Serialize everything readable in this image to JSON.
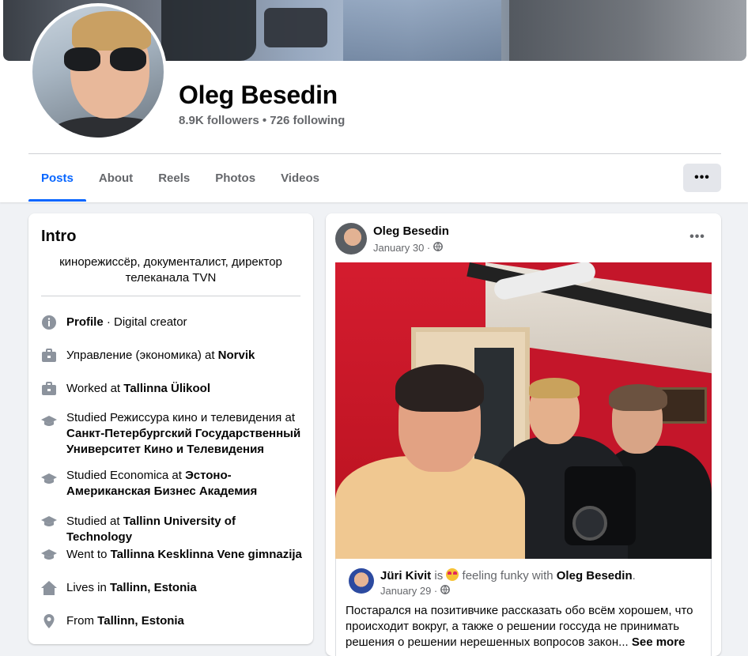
{
  "profile": {
    "name": "Oleg Besedin",
    "stats": "8.9K followers • 726 following"
  },
  "tabs": [
    {
      "label": "Posts",
      "active": true
    },
    {
      "label": "About",
      "active": false
    },
    {
      "label": "Reels",
      "active": false
    },
    {
      "label": "Photos",
      "active": false
    },
    {
      "label": "Videos",
      "active": false
    }
  ],
  "more_label": "•••",
  "intro": {
    "title": "Intro",
    "bio": "кинорежиссёр, документалист, директор телеканала TVN",
    "items": [
      {
        "icon": "info-icon",
        "prefix": "",
        "bold": "Profile",
        "suffix": " · Digital creator"
      },
      {
        "icon": "briefcase-icon",
        "prefix": "Управление (экономика) at ",
        "bold": "Norvik",
        "suffix": ""
      },
      {
        "icon": "briefcase-icon",
        "prefix": "Worked at ",
        "bold": "Tallinna Ülikool",
        "suffix": ""
      },
      {
        "icon": "graduation-cap-icon",
        "prefix": "Studied Режиссура кино и телевидения at ",
        "bold": "Санкт-Петербургский Государственный Университет Кино и Телевидения",
        "suffix": ""
      },
      {
        "icon": "graduation-cap-icon",
        "prefix": "Studied Economica at ",
        "bold": "Эстоно-Американская Бизнес Академия",
        "suffix": ""
      },
      {
        "icon": "graduation-cap-icon",
        "prefix": "Studied at ",
        "bold": "Tallinn University of Technology",
        "suffix": ""
      },
      {
        "icon": "graduation-cap-icon",
        "prefix": "Went to ",
        "bold": "Tallinna Kesklinna Vene gimnazija",
        "suffix": ""
      },
      {
        "icon": "home-icon",
        "prefix": "Lives in ",
        "bold": "Tallinn, Estonia",
        "suffix": ""
      },
      {
        "icon": "location-pin-icon",
        "prefix": "From ",
        "bold": "Tallinn, Estonia",
        "suffix": ""
      }
    ]
  },
  "post": {
    "author": "Oleg Besedin",
    "date": "January 30 ·",
    "more_label": "•••",
    "shared": {
      "author": "Jüri Kivit",
      "is_text": " is ",
      "feeling": " feeling funky with ",
      "tagged": "Oleg Besedin",
      "period": ".",
      "date": "January 29 ·",
      "text": "Постарался на позитивчике рассказать обо всём хорошем, что происходит вокруг, а также о решении госсуда не принимать решения о решении нерешенных вопросов закон... ",
      "see_more": "See more"
    }
  },
  "colors": {
    "accent": "#0866ff",
    "background": "#f0f2f5",
    "secondary_text": "#65676b"
  }
}
